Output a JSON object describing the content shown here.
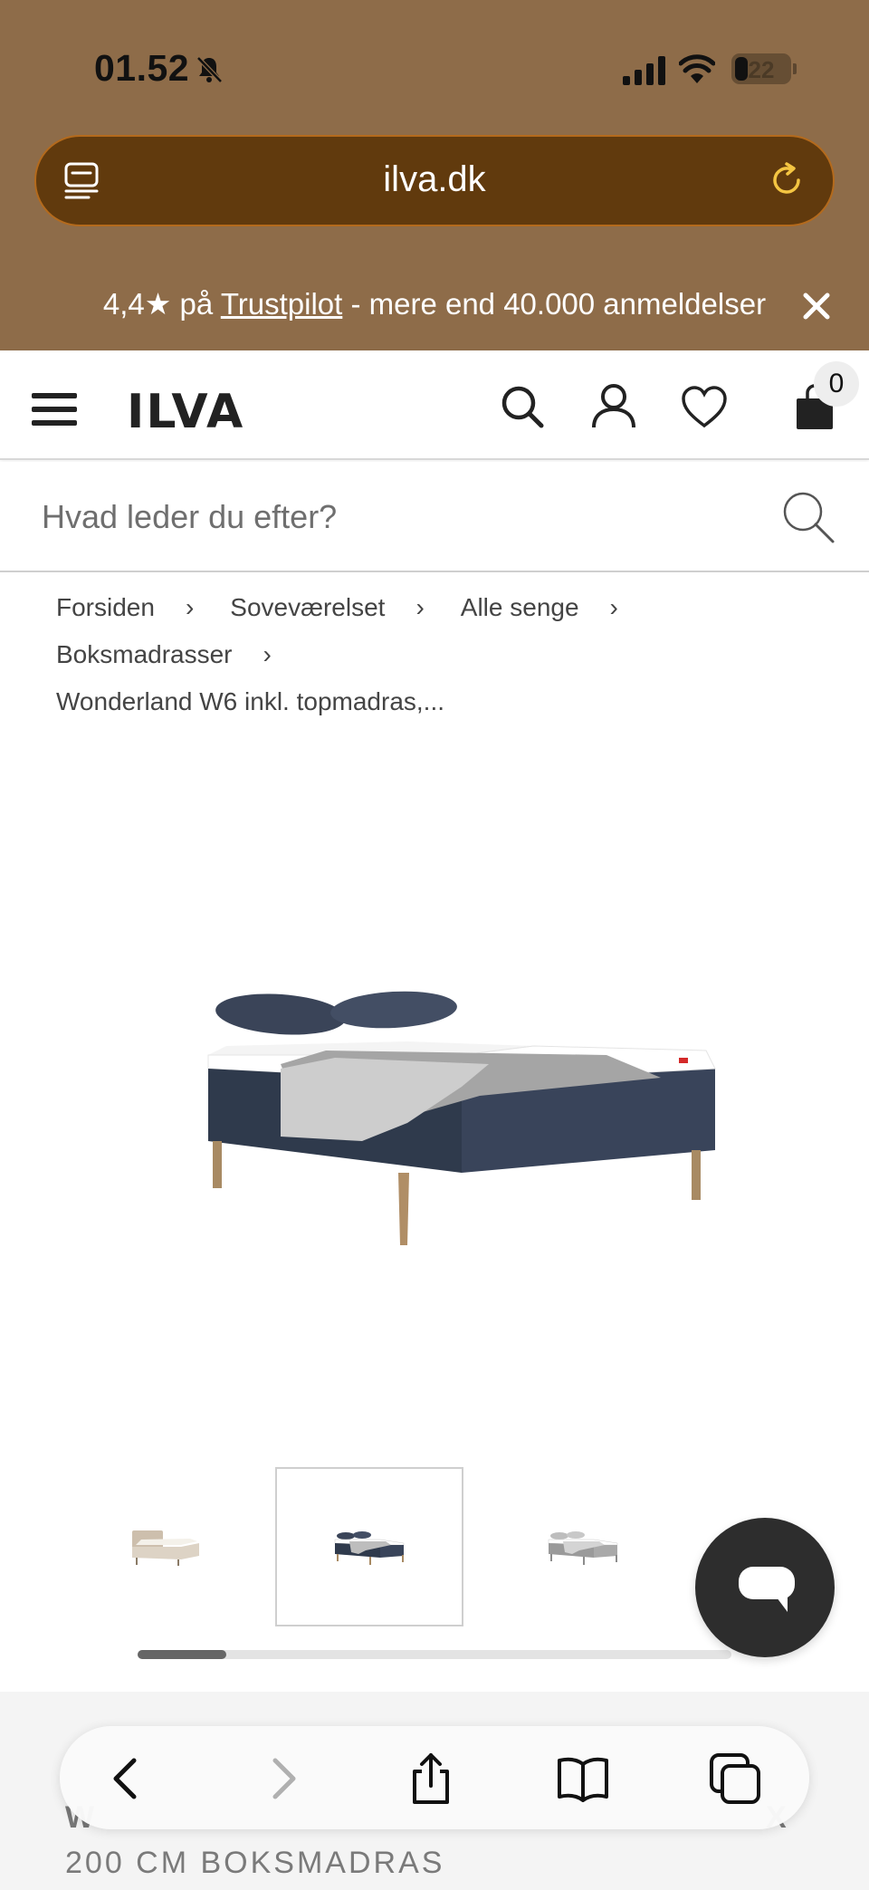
{
  "status": {
    "time": "01.52",
    "battery": "22"
  },
  "browser": {
    "url": "ilva.dk"
  },
  "promo": {
    "prefix": "4,4★ på ",
    "link": "Trustpilot",
    "suffix": " - mere end 40.000 anmeldelser"
  },
  "header": {
    "logo": "ILVA",
    "cart_count": "0"
  },
  "search": {
    "placeholder": "Hvad leder du efter?"
  },
  "breadcrumb": {
    "items": [
      "Forsiden",
      "Soveværelset",
      "Alle senge",
      "Boksmadrasser"
    ],
    "current": "Wonderland W6 inkl. topmadras,..."
  },
  "gallery": {
    "thumb_count": 3,
    "active_index": 1,
    "scroll_fraction": 0.15
  },
  "product": {
    "title_line_1": "W",
    "title_line_1_end": "X",
    "title_line_2": "200 CM BOKSMADRAS"
  },
  "colors": {
    "chrome_bg": "#8e6c49",
    "url_bar": "#613a0d",
    "chat_button": "#2d2d2d"
  },
  "icons": [
    "bell-slash-icon",
    "signal-icon",
    "wifi-icon",
    "reader-icon",
    "reload-icon",
    "close-icon",
    "menu-icon",
    "search-icon",
    "user-icon",
    "heart-icon",
    "bag-icon",
    "chat-icon",
    "back-icon",
    "forward-icon",
    "share-icon",
    "bookmarks-icon",
    "tabs-icon"
  ]
}
